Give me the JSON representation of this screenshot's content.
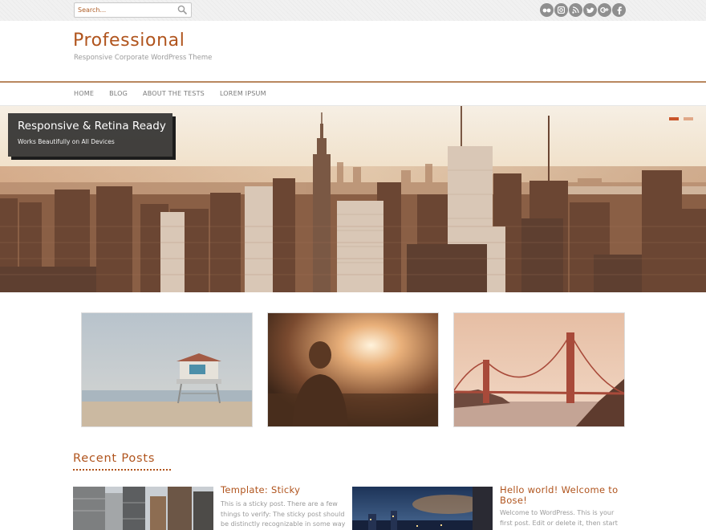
{
  "search": {
    "placeholder": "Search..."
  },
  "social_icons": [
    "flickr-icon",
    "instagram-icon",
    "rss-icon",
    "twitter-icon",
    "google-plus-icon",
    "facebook-icon"
  ],
  "header": {
    "title": "Professional",
    "tagline": "Responsive Corporate WordPress Theme"
  },
  "nav": {
    "items": [
      "HOME",
      "BLOG",
      "ABOUT THE TESTS",
      "LOREM IPSUM"
    ]
  },
  "hero": {
    "title": "Responsive & Retina Ready",
    "subtitle": "Works Beautifully on All Devices",
    "slides": 2,
    "active_slide": 1
  },
  "features": [
    "lifeguard-tower-beach-image",
    "woman-sunset-image",
    "golden-gate-bridge-image"
  ],
  "recent": {
    "heading": "Recent Posts",
    "posts": [
      {
        "title": "Template: Sticky",
        "excerpt": "This is a sticky post. There are a few things to verify: The sticky post should be distinctly recognizable in some way in"
      },
      {
        "title": "Hello world! Welcome to Bose!",
        "excerpt": "Welcome to WordPress. This is your first post. Edit or delete it, then start"
      }
    ]
  },
  "colors": {
    "accent": "#b0541d",
    "nav_border": "#b9875f",
    "icon_gray": "#8f8f8f",
    "slide_dot_active": "#c9552a",
    "slide_dot_inactive": "#e0a888"
  }
}
